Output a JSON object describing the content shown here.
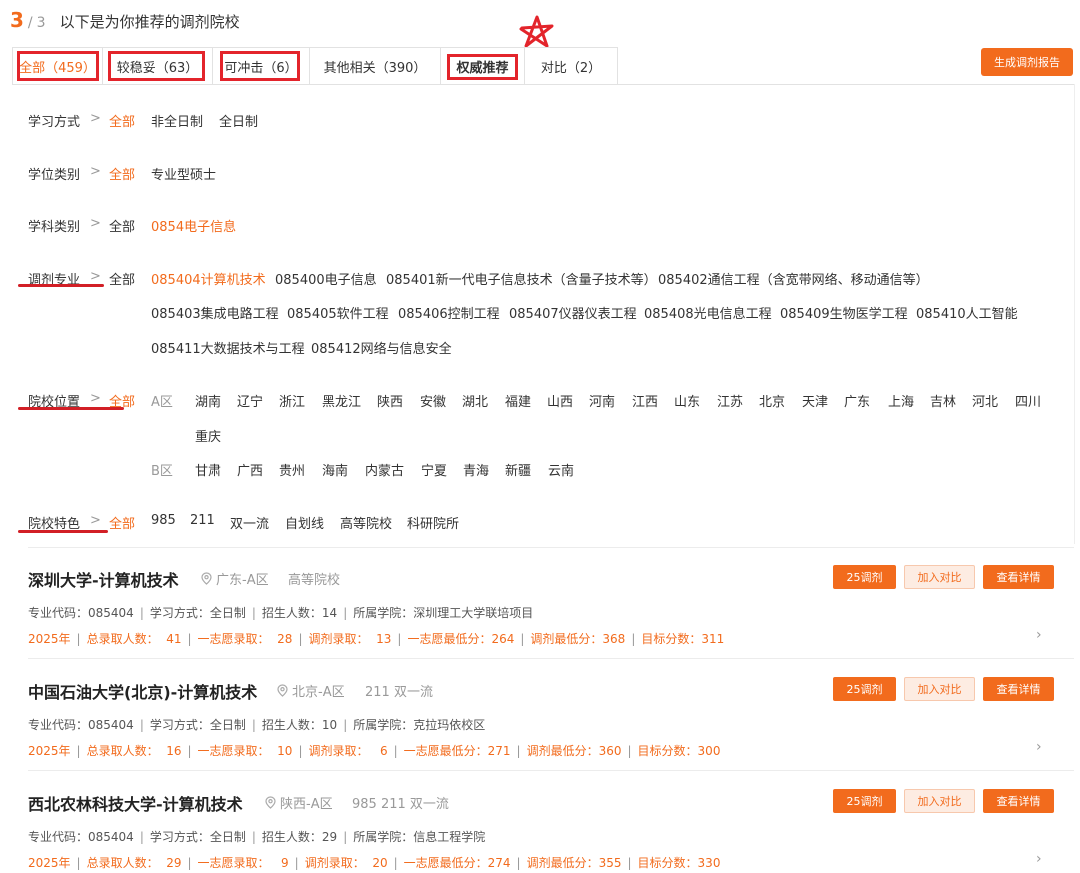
{
  "header": {
    "current": "3",
    "separator": "/",
    "total": "3",
    "title": "以下是为你推荐的调剂院校"
  },
  "tabs": [
    {
      "label": "全部（459）"
    },
    {
      "label": "较稳妥（63）"
    },
    {
      "label": "可冲击（6）"
    },
    {
      "label": "其他相关（390）"
    },
    {
      "label": "权威推荐"
    },
    {
      "label": "对比（2）"
    }
  ],
  "report_button": "生成调剂报告",
  "filters": {
    "arrow": ">",
    "study_mode": {
      "label": "学习方式",
      "options": [
        "全部",
        "非全日制",
        "全日制"
      ]
    },
    "degree_type": {
      "label": "学位类别",
      "options": [
        "全部",
        "专业型硕士"
      ]
    },
    "discipline": {
      "label": "学科类别",
      "options": [
        "全部",
        "0854电子信息"
      ]
    },
    "major": {
      "label": "调剂专业",
      "all": "全部",
      "row1": [
        "085404计算机技术",
        "085400电子信息",
        "085401新一代电子信息技术（含量子技术等）",
        "085402通信工程（含宽带网络、移动通信等）"
      ],
      "row2": [
        "085403集成电路工程",
        "085405软件工程",
        "085406控制工程",
        "085407仪器仪表工程",
        "085408光电信息工程",
        "085409生物医学工程",
        "085410人工智能"
      ],
      "row3": [
        "085411大数据技术与工程",
        "085412网络与信息安全"
      ]
    },
    "location": {
      "label": "院校位置",
      "all": "全部",
      "a_label": "A区",
      "a_regions": [
        "湖南",
        "辽宁",
        "浙江",
        "黑龙江",
        "陕西",
        "安徽",
        "湖北",
        "福建",
        "山西",
        "河南",
        "江西",
        "山东",
        "江苏",
        "北京",
        "天津",
        "广东",
        "上海",
        "吉林",
        "河北",
        "四川"
      ],
      "a_regions_2": [
        "重庆"
      ],
      "b_label": "B区",
      "b_regions": [
        "甘肃",
        "广西",
        "贵州",
        "海南",
        "内蒙古",
        "宁夏",
        "青海",
        "新疆",
        "云南"
      ]
    },
    "features": {
      "label": "院校特色",
      "options": [
        "全部",
        "985",
        "211",
        "双一流",
        "自划线",
        "高等院校",
        "科研院所"
      ]
    }
  },
  "cards": [
    {
      "title": "深圳大学-计算机技术",
      "location": "广东-A区",
      "tags": "高等院校",
      "btn_adjust": "25调剂",
      "btn_compare": "加入对比",
      "btn_detail": "查看详情",
      "info": [
        "专业代码：085404",
        "学习方式：全日制",
        "招生人数：14",
        "所属学院：深圳理工大学联培项目"
      ],
      "stats": [
        "2025年",
        "总录取人数：  41",
        "一志愿录取：  28",
        "调剂录取：  13",
        "一志愿最低分：264",
        "调剂最低分：368",
        "目标分数：311"
      ]
    },
    {
      "title": "中国石油大学(北京)-计算机技术",
      "location": "北京-A区",
      "tags": "211 双一流",
      "btn_adjust": "25调剂",
      "btn_compare": "加入对比",
      "btn_detail": "查看详情",
      "info": [
        "专业代码：085404",
        "学习方式：全日制",
        "招生人数：10",
        "所属学院：克拉玛依校区"
      ],
      "stats": [
        "2025年",
        "总录取人数：  16",
        "一志愿录取：  10",
        "调剂录取：   6",
        "一志愿最低分：271",
        "调剂最低分：360",
        "目标分数：300"
      ]
    },
    {
      "title": "西北农林科技大学-计算机技术",
      "location": "陕西-A区",
      "tags": "985 211 双一流",
      "btn_adjust": "25调剂",
      "btn_compare": "加入对比",
      "btn_detail": "查看详情",
      "info": [
        "专业代码：085404",
        "学习方式：全日制",
        "招生人数：29",
        "所属学院：信息工程学院"
      ],
      "stats": [
        "2025年",
        "总录取人数：  29",
        "一志愿录取：   9",
        "调剂录取：  20",
        "一志愿最低分：274",
        "调剂最低分：355",
        "目标分数：330"
      ]
    }
  ],
  "chevron": "›",
  "colors": {
    "accent": "#f26b1d",
    "annotation": "#e3242b"
  }
}
